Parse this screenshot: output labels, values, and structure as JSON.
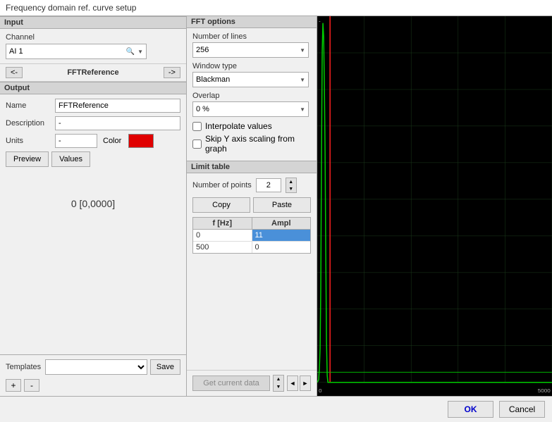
{
  "title": "Frequency domain ref. curve setup",
  "input": {
    "section_label": "Input",
    "channel_label": "Channel",
    "channel_value": "AI 1"
  },
  "nav": {
    "back_label": "<-",
    "center_label": "FFTReference",
    "forward_label": "->"
  },
  "output": {
    "section_label": "Output",
    "name_label": "Name",
    "name_value": "FFTReference",
    "description_label": "Description",
    "description_value": "-",
    "units_label": "Units",
    "units_value": "-",
    "color_label": "Color",
    "preview_btn": "Preview",
    "values_btn": "Values",
    "preview_value": "0 [0,0000]"
  },
  "templates": {
    "label": "Templates",
    "save_label": "Save",
    "add_label": "+",
    "remove_label": "-"
  },
  "fft_options": {
    "section_label": "FFT options",
    "lines_label": "Number of lines",
    "lines_value": "256",
    "window_label": "Window type",
    "window_value": "Blackman",
    "overlap_label": "Overlap",
    "overlap_value": "0 %",
    "interpolate_label": "Interpolate values",
    "skip_axis_label": "Skip Y axis scaling from graph"
  },
  "limit_table": {
    "section_label": "Limit table",
    "points_label": "Number of points",
    "points_value": "2",
    "copy_label": "Copy",
    "paste_label": "Paste",
    "columns": [
      "f [Hz]",
      "Ampl"
    ],
    "rows": [
      {
        "freq": "0",
        "ampl": "11",
        "selected": true
      },
      {
        "freq": "500",
        "ampl": "0",
        "selected": false
      }
    ],
    "get_data_label": "Get current data"
  },
  "bottom": {
    "ok_label": "OK",
    "cancel_label": "Cancel"
  }
}
